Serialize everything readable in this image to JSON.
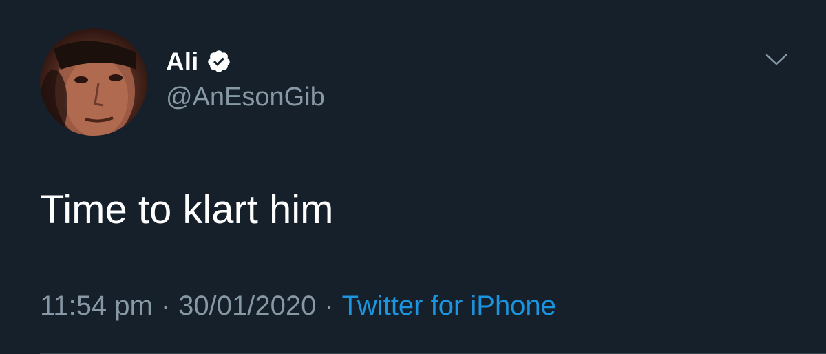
{
  "tweet": {
    "author": {
      "display_name": "Ali",
      "handle": "@AnEsonGib",
      "verified": true,
      "verified_icon": "verified-badge-icon",
      "avatar": "profile-photo"
    },
    "text": "Time to klart him",
    "time": "11:54 pm",
    "date": "30/01/2020",
    "separator": "·",
    "source": "Twitter for iPhone",
    "menu_icon": "chevron-down-icon"
  },
  "colors": {
    "background": "#15202b",
    "primary_text": "#ffffff",
    "secondary_text": "#8899a6",
    "link": "#1b95e0",
    "divider": "#38444d"
  }
}
